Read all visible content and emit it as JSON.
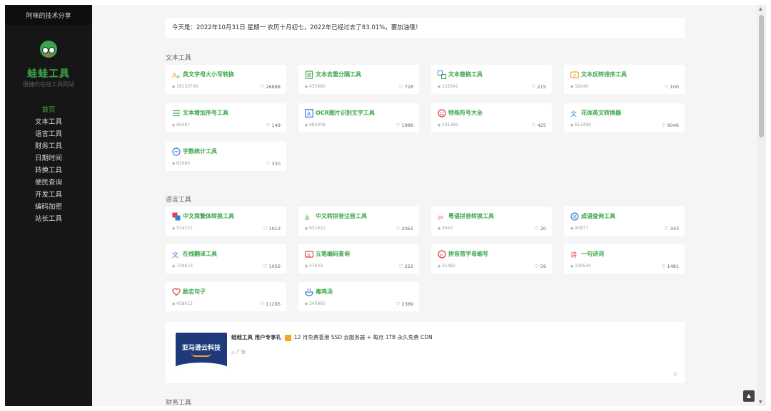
{
  "sidebar": {
    "top_title": "阿咪的技术分享",
    "brand": "蛙蛙工具",
    "tagline": "便捷的在线工具网站",
    "nav": [
      {
        "label": "首页",
        "active": true
      },
      {
        "label": "文本工具"
      },
      {
        "label": "语言工具"
      },
      {
        "label": "财务工具"
      },
      {
        "label": "日期时间"
      },
      {
        "label": "转换工具"
      },
      {
        "label": "便民查询"
      },
      {
        "label": "开发工具"
      },
      {
        "label": "编码加密"
      },
      {
        "label": "站长工具"
      }
    ]
  },
  "datebar": "今天是：2022年10月31日 星期一 农历十月初七，2022年已经过去了83.01%，要加油哦！",
  "sections": {
    "text_tools": {
      "title": "文本工具",
      "cards": [
        {
          "title": "英文字母大小写转换",
          "views": "18133706",
          "likes": "26888",
          "icon": "letter-case-icon"
        },
        {
          "title": "文本去重分隔工具",
          "views": "435680",
          "likes": "728",
          "icon": "document-icon"
        },
        {
          "title": "文本替换工具",
          "views": "122641",
          "likes": "215",
          "icon": "replace-icon"
        },
        {
          "title": "文本反转排序工具",
          "views": "59240",
          "likes": "100",
          "icon": "reverse-icon"
        },
        {
          "title": "文本增加序号工具",
          "views": "60587",
          "likes": "149",
          "icon": "list-icon"
        },
        {
          "title": "OCR图片识别文字工具",
          "views": "682008",
          "likes": "1988",
          "icon": "ocr-icon"
        },
        {
          "title": "特殊符号大全",
          "views": "141369",
          "likes": "425",
          "icon": "smiley-icon"
        },
        {
          "title": "花体英文转换器",
          "views": "613498",
          "likes": "6046",
          "icon": "fancy-text-icon"
        },
        {
          "title": "字数统计工具",
          "views": "81080",
          "likes": "330",
          "icon": "count-icon"
        }
      ]
    },
    "language_tools": {
      "title": "语言工具",
      "cards": [
        {
          "title": "中文简繁体转换工具",
          "views": "514721",
          "likes": "1013",
          "icon": "simplified-traditional-icon"
        },
        {
          "title": "中文转拼音注音工具",
          "views": "951622",
          "likes": "2061",
          "icon": "pinyin-icon"
        },
        {
          "title": "粤语拼音转换工具",
          "views": "2643",
          "likes": "20",
          "icon": "cantonese-icon"
        },
        {
          "title": "成语查询工具",
          "views": "90877",
          "likes": "343",
          "icon": "idiom-icon"
        },
        {
          "title": "在线翻译工具",
          "views": "729610",
          "likes": "1056",
          "icon": "translate-icon"
        },
        {
          "title": "五笔编码查询",
          "views": "47633",
          "likes": "222",
          "icon": "wubi-icon"
        },
        {
          "title": "拼音首字母缩写",
          "views": "31482",
          "likes": "59",
          "icon": "initials-icon"
        },
        {
          "title": "一句诗词",
          "views": "199544",
          "likes": "1481",
          "icon": "poem-icon"
        },
        {
          "title": "励志句子",
          "views": "458013",
          "likes": "11295",
          "icon": "heart-icon"
        },
        {
          "title": "毒鸡汤",
          "views": "340960",
          "likes": "2389",
          "icon": "soup-icon"
        }
      ]
    },
    "finance_tools": {
      "title": "财务工具"
    }
  },
  "ad": {
    "image_text": "亚马逊云科技",
    "bold": "蛙蛙工具 用户专享礼",
    "text": "12 月免费香港 SSD 云服务器 + 每月 1TB 永久免费 CDN",
    "label": "广告",
    "close": "×"
  },
  "colors": {
    "accent": "#3aa64a",
    "sidebar": "#161616"
  }
}
